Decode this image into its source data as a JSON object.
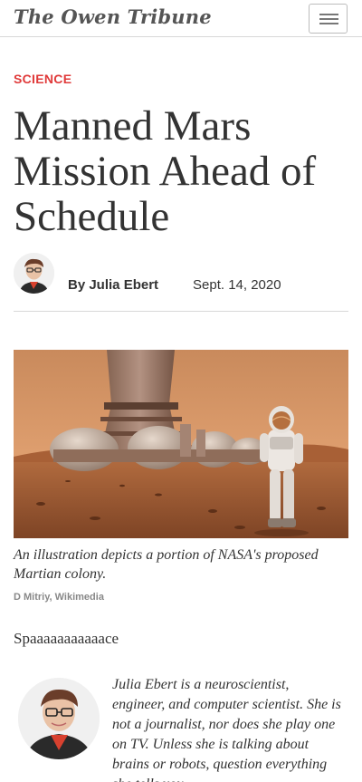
{
  "header": {
    "masthead": "The Owen Tribune",
    "menu_icon": "hamburger-menu-icon"
  },
  "article": {
    "section": "SCIENCE",
    "headline": "Manned Mars Mission Ahead of Schedule",
    "author": "By Julia Ebert",
    "date": "Sept. 14, 2020",
    "image": {
      "caption": "An illustration depicts a portion of NASA's proposed Martian colony.",
      "credit": "D Mitriy, Wikimedia"
    },
    "body": "Spaaaaaaaaaaace",
    "bio": "Julia Ebert is a neuroscientist, engineer, and computer scientist. She is not a journalist, nor does she play one on TV. Unless she is talking about brains or robots, question everything she tells you."
  },
  "colors": {
    "section": "#e03a3a",
    "text": "#333333",
    "divider": "#d8d8d8",
    "mars_sky": "#d98c52",
    "mars_ground": "#9c5a34"
  }
}
